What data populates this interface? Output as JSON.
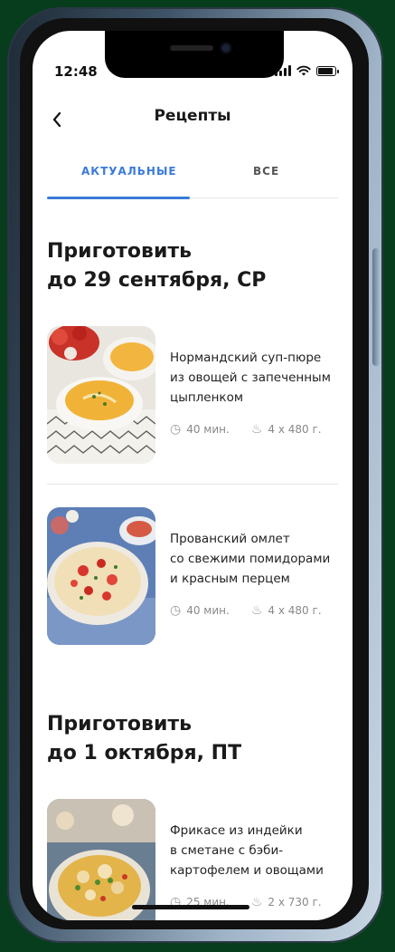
{
  "status": {
    "time": "12:48"
  },
  "header": {
    "title": "Рецепты",
    "back_icon": "chevron-left-icon"
  },
  "tabs": [
    {
      "label": "АКТУАЛЬНЫЕ",
      "active": true
    },
    {
      "label": "ВСЕ",
      "active": false
    }
  ],
  "sections": [
    {
      "title_line1": "Приготовить",
      "title_line2": "до 29 сентября, СР",
      "recipes": [
        {
          "title_lines": [
            "Нормандский суп-пюре",
            "из овощей с запеченным",
            "цыпленком"
          ],
          "time": "40 мин.",
          "portions": "4 х 480 г."
        },
        {
          "title_lines": [
            "Прованский омлет",
            "со свежими помидорами",
            "и красным перцем"
          ],
          "time": "40 мин.",
          "portions": "4 х 480 г."
        }
      ]
    },
    {
      "title_line1": "Приготовить",
      "title_line2": "до 1 октября, ПТ",
      "recipes": [
        {
          "title_lines": [
            "Фрикасе из индейки",
            "в сметане с бэби-",
            "картофелем и овощами"
          ],
          "time": "25 мин.",
          "portions": "2 х 730 г."
        }
      ]
    }
  ],
  "colors": {
    "accent": "#3b7ad9",
    "background_outer": "#073d1d"
  }
}
